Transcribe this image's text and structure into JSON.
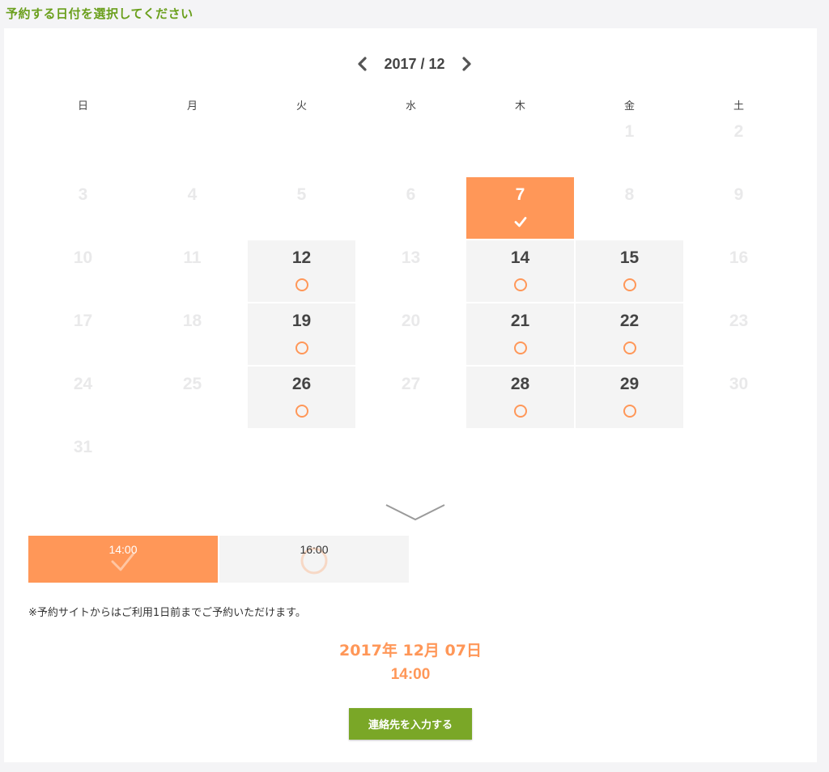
{
  "page": {
    "heading": "予約する日付を選択してください"
  },
  "calendar": {
    "month_label": "2017 / 12",
    "weekdays": [
      "日",
      "月",
      "火",
      "水",
      "木",
      "金",
      "土"
    ],
    "cells": [
      {
        "day": "",
        "state": "blank"
      },
      {
        "day": "",
        "state": "blank"
      },
      {
        "day": "",
        "state": "blank"
      },
      {
        "day": "",
        "state": "blank"
      },
      {
        "day": "",
        "state": "blank"
      },
      {
        "day": "1",
        "state": "disabled"
      },
      {
        "day": "2",
        "state": "disabled"
      },
      {
        "day": "3",
        "state": "disabled"
      },
      {
        "day": "4",
        "state": "disabled"
      },
      {
        "day": "5",
        "state": "disabled"
      },
      {
        "day": "6",
        "state": "disabled"
      },
      {
        "day": "7",
        "state": "selected"
      },
      {
        "day": "8",
        "state": "disabled"
      },
      {
        "day": "9",
        "state": "disabled"
      },
      {
        "day": "10",
        "state": "disabled"
      },
      {
        "day": "11",
        "state": "disabled"
      },
      {
        "day": "12",
        "state": "available"
      },
      {
        "day": "13",
        "state": "disabled"
      },
      {
        "day": "14",
        "state": "available"
      },
      {
        "day": "15",
        "state": "available"
      },
      {
        "day": "16",
        "state": "disabled"
      },
      {
        "day": "17",
        "state": "disabled"
      },
      {
        "day": "18",
        "state": "disabled"
      },
      {
        "day": "19",
        "state": "available"
      },
      {
        "day": "20",
        "state": "disabled"
      },
      {
        "day": "21",
        "state": "available"
      },
      {
        "day": "22",
        "state": "available"
      },
      {
        "day": "23",
        "state": "disabled"
      },
      {
        "day": "24",
        "state": "disabled"
      },
      {
        "day": "25",
        "state": "disabled"
      },
      {
        "day": "26",
        "state": "available"
      },
      {
        "day": "27",
        "state": "disabled"
      },
      {
        "day": "28",
        "state": "available"
      },
      {
        "day": "29",
        "state": "available"
      },
      {
        "day": "30",
        "state": "disabled"
      },
      {
        "day": "31",
        "state": "disabled"
      }
    ]
  },
  "time_slots": [
    {
      "label": "14:00",
      "state": "selected"
    },
    {
      "label": "16:00",
      "state": "available"
    }
  ],
  "note": "※予約サイトからはご利用1日前までご予約いただけます。",
  "summary": {
    "date": "2017年 12月 07日",
    "time": "14:00"
  },
  "next_button": "連絡先を入力する",
  "colors": {
    "accent": "#ff9758",
    "heading_green": "#6a9f1c",
    "button_green": "#7aa727",
    "available_bg": "#f4f4f4",
    "disabled_text": "#e9e9ea"
  }
}
